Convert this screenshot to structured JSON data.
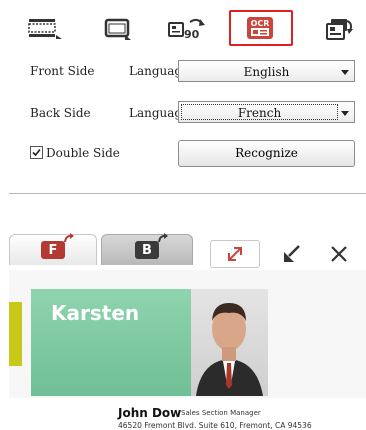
{
  "toolbar": {
    "scan_icon": "scan-feed-icon",
    "window_icon": "window-icon",
    "rotate_icon": "rotate-90-icon",
    "ocr_icon": "ocr-icon",
    "ocr_label": "OCR",
    "rotate_label": "90",
    "export_icon": "export-icon",
    "ocr_highlight_color": "#e0201f"
  },
  "front": {
    "label": "Front Side",
    "language_label": "Language",
    "language_value": "English"
  },
  "back": {
    "label": "Back Side",
    "language_label": "Language",
    "language_value": "French"
  },
  "double_side": {
    "label": "Double Side",
    "checked": true
  },
  "recognize_label": "Recognize",
  "tabs": {
    "front_letter": "F",
    "back_letter": "B",
    "front_color": "#b33a32",
    "back_color": "#3a3a3a"
  },
  "card": {
    "name_banner": "Karsten",
    "person_name": "John Dow",
    "person_title": "Sales Section Manager",
    "address": "46520 Fremont Blvd. Suite 610, Fremont, CA 94536",
    "banner_color": "#7dc8a0",
    "accent_color": "#c8c81a"
  }
}
